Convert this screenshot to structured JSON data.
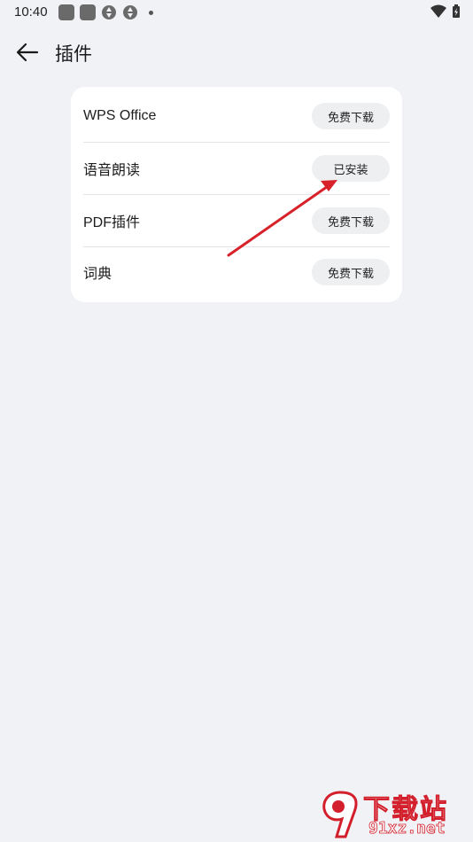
{
  "status_bar": {
    "time": "10:40"
  },
  "header": {
    "title": "插件"
  },
  "plugins": [
    {
      "name": "WPS Office",
      "action": "免费下载"
    },
    {
      "name": "语音朗读",
      "action": "已安装"
    },
    {
      "name": "PDF插件",
      "action": "免费下载"
    },
    {
      "name": "词典",
      "action": "免费下载"
    }
  ],
  "annotation": {
    "arrow_color": "#d8222a"
  },
  "watermark": {
    "site_name": "下载站",
    "url": "91xz.net",
    "brand_color": "#d21f2b"
  }
}
